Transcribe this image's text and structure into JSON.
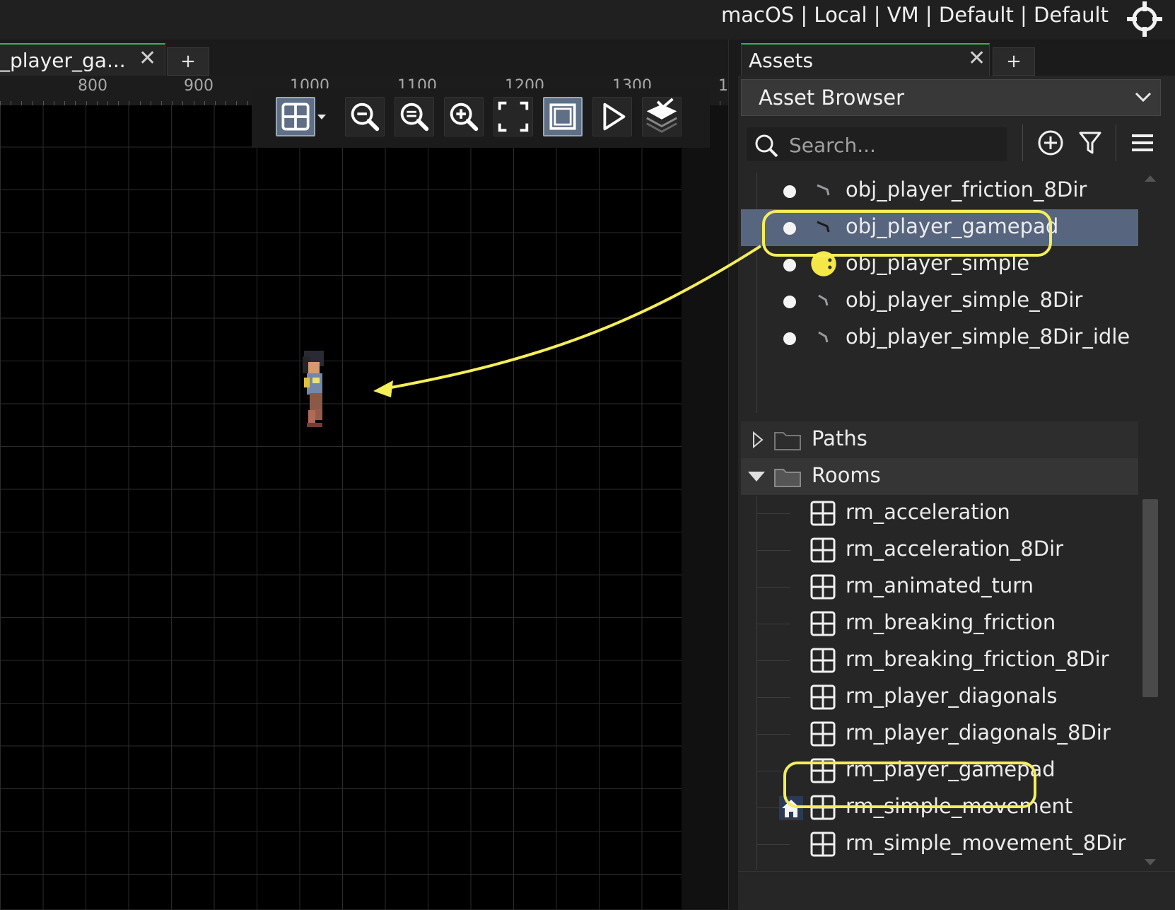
{
  "topbar": {
    "target": "macOS | Local | VM | Default | Default"
  },
  "room_editor": {
    "tab_label": "_player_ga...",
    "add_tab": "+",
    "ruler": [
      "800",
      "900",
      "1000",
      "1100",
      "1200",
      "1300",
      "1"
    ]
  },
  "assets": {
    "tab_label": "Assets",
    "add_tab": "+",
    "browser_title": "Asset Browser",
    "search_placeholder": "Search...",
    "objects": [
      "obj_player_friction_8Dir",
      "obj_player_gamepad",
      "obj_player_simple",
      "obj_player_simple_8Dir",
      "obj_player_simple_8Dir_idle"
    ],
    "selected_object": "obj_player_gamepad",
    "folders": {
      "paths": "Paths",
      "rooms": "Rooms"
    },
    "rooms": [
      "rm_acceleration",
      "rm_acceleration_8Dir",
      "rm_animated_turn",
      "rm_breaking_friction",
      "rm_breaking_friction_8Dir",
      "rm_player_diagonals",
      "rm_player_diagonals_8Dir",
      "rm_player_gamepad",
      "rm_simple_movement",
      "rm_simple_movement_8Dir"
    ],
    "home_room": "rm_simple_movement"
  },
  "colors": {
    "accent_green": "#3fae4f",
    "highlight_yellow": "#f4ee5a",
    "selection": "#57657f"
  }
}
